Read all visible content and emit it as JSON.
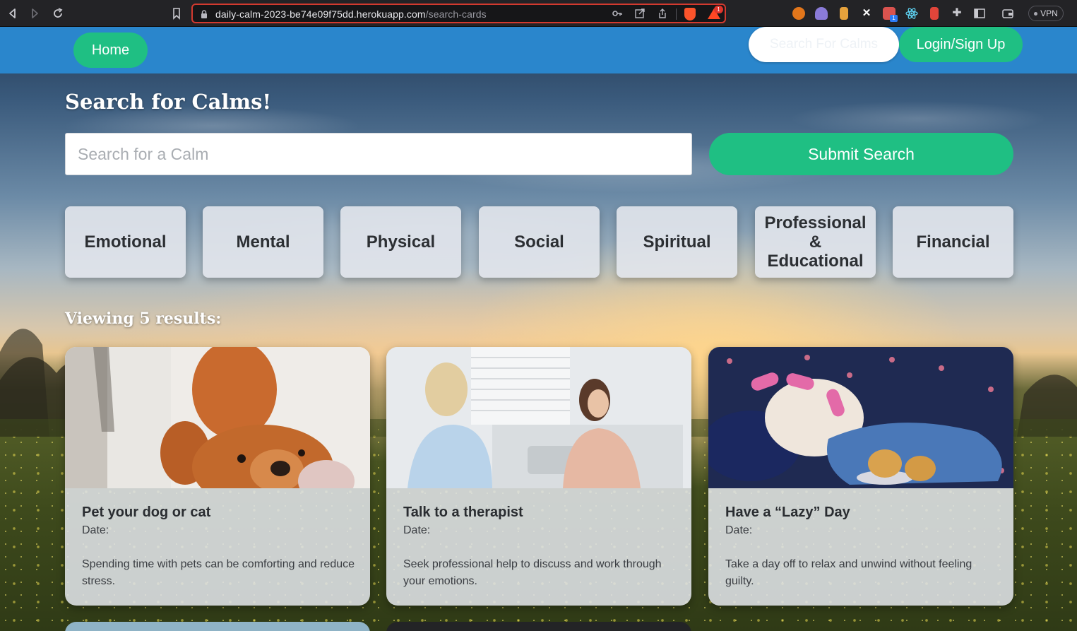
{
  "browser": {
    "url_host": "daily-calm-2023-be74e09f75dd.herokuapp.com",
    "url_path": "/search-cards",
    "bat_badge": "1",
    "ext_badge": "1",
    "vpn_label": "VPN"
  },
  "nav": {
    "home_label": "Home",
    "search_label": "Search For Calms",
    "login_label": "Login/Sign Up"
  },
  "page": {
    "title": "Search for Calms!",
    "search_placeholder": "Search for a Calm",
    "submit_label": "Submit Search",
    "results_label": "Viewing 5 results:"
  },
  "categories": [
    "Emotional",
    "Mental",
    "Physical",
    "Social",
    "Spiritual",
    "Professional & Educational",
    "Financial"
  ],
  "cards": [
    {
      "title": "Pet your dog or cat",
      "date_label": "Date:",
      "description": "Spending time with pets can be comforting and reduce stress.",
      "image": "golden-retriever-photo"
    },
    {
      "title": "Talk to a therapist",
      "date_label": "Date:",
      "description": "Seek professional help to discuss and work through your emotions.",
      "image": "therapy-session-photo"
    },
    {
      "title": "Have a “Lazy” Day",
      "date_label": "Date:",
      "description": "Take a day off to relax and unwind without feeling guilty.",
      "image": "bulldog-in-curlers-photo"
    }
  ],
  "colors": {
    "navbar": "#2a86cc",
    "accent_green": "#1fbf83",
    "url_highlight": "#d33a2f"
  }
}
